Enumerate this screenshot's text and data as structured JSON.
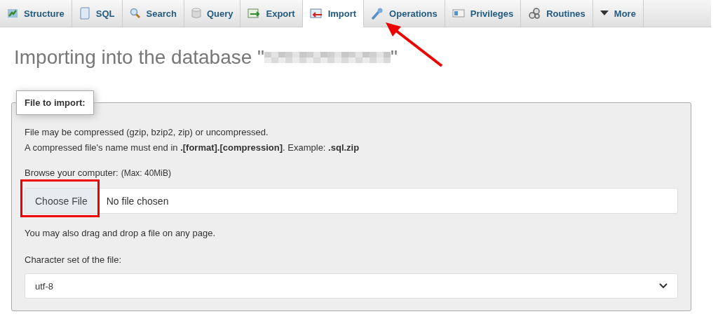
{
  "tabs": [
    {
      "label": "Structure",
      "selected": false
    },
    {
      "label": "SQL",
      "selected": false
    },
    {
      "label": "Search",
      "selected": false
    },
    {
      "label": "Query",
      "selected": false
    },
    {
      "label": "Export",
      "selected": false
    },
    {
      "label": "Import",
      "selected": true
    },
    {
      "label": "Operations",
      "selected": false
    },
    {
      "label": "Privileges",
      "selected": false
    },
    {
      "label": "Routines",
      "selected": false
    },
    {
      "label": "More",
      "selected": false
    }
  ],
  "heading": {
    "before": "Importing into the database \"",
    "after": "\""
  },
  "fieldset": {
    "legend": "File to import:",
    "notes": [
      "File may be compressed (gzip, bzip2, zip) or uncompressed.",
      "A compressed file's name must end in **.[format].[compression]**. Example: **.sql.zip**"
    ],
    "browse_label": "Browse your computer:",
    "max_size": "(Max: 40MiB)",
    "file_button": "Choose File",
    "file_status": "No file chosen",
    "drag_note": "You may also drag and drop a file on any page.",
    "charset_label": "Character set of the file:",
    "charset_value": "utf-8"
  },
  "annotations": {
    "arrow": true,
    "highlight": true
  }
}
